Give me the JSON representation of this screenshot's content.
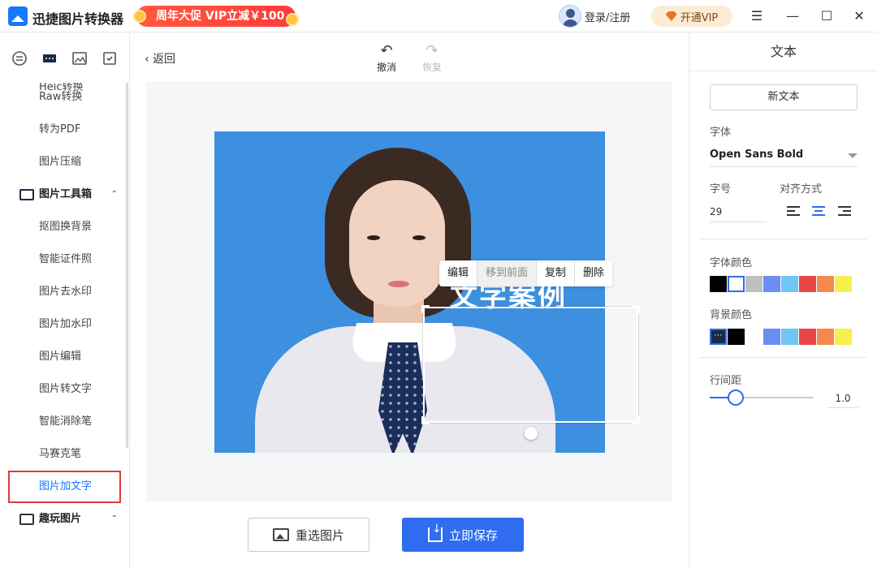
{
  "app": {
    "name": "迅捷图片转换器",
    "promo": "周年大促 VIP立减￥100",
    "login": "登录/注册",
    "vip": "开通VIP",
    "accent": "#2f6cf0"
  },
  "sidebar": {
    "partial_top": "Heic转换",
    "items": [
      {
        "label": "Raw转换"
      },
      {
        "label": "转为PDF"
      },
      {
        "label": "图片压缩"
      }
    ],
    "group_tools": "图片工具箱",
    "tools": [
      {
        "label": "抠图换背景"
      },
      {
        "label": "智能证件照"
      },
      {
        "label": "图片去水印"
      },
      {
        "label": "图片加水印"
      },
      {
        "label": "图片编辑"
      },
      {
        "label": "图片转文字"
      },
      {
        "label": "智能消除笔"
      },
      {
        "label": "马赛克笔"
      }
    ],
    "active_item": "图片加文字",
    "group_fun": "趣玩图片"
  },
  "editor": {
    "back": "返回",
    "undo": "撤消",
    "redo": "恢复",
    "overlay_text": "文字案例",
    "context_menu": [
      "编辑",
      "移到前面",
      "复制",
      "删除"
    ],
    "reselect": "重选图片",
    "save": "立即保存"
  },
  "panel": {
    "title": "文本",
    "new_text": "新文本",
    "font_label": "字体",
    "font_value": "Open Sans Bold",
    "size_label": "字号",
    "size_value": "29",
    "align_label": "对齐方式",
    "align_selected": "center",
    "font_color_label": "字体颜色",
    "font_colors": [
      "#000000",
      "#ffffff",
      "#bfbfbf",
      "#6d8df5",
      "#6ec6f5",
      "#e84545",
      "#f5884f",
      "#f7f04a"
    ],
    "bg_color_label": "背景颜色",
    "bg_colors": [
      "#1a2a45",
      "#000000",
      "#ffffff",
      "#6d8df5",
      "#6ec6f5",
      "#e84545",
      "#f5884f",
      "#f7f04a"
    ],
    "line_spacing_label": "行间距",
    "line_spacing_value": "1.0"
  }
}
